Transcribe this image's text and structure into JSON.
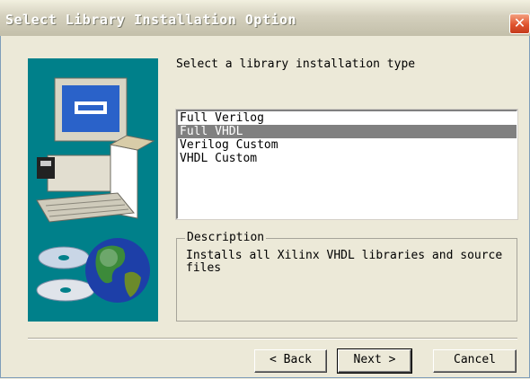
{
  "window": {
    "title": "Select Library Installation Option",
    "close_icon": "close-icon"
  },
  "main": {
    "prompt": "Select a library installation type",
    "options": [
      "Full Verilog",
      "Full VHDL",
      "Verilog Custom",
      "VHDL Custom"
    ],
    "selected_option": "Full VHDL",
    "description_label": "Description",
    "description_line1": "Installs all Xilinx VHDL libraries and source",
    "description_line2": "files"
  },
  "buttons": {
    "back_label": "< Back",
    "next_label": "Next >",
    "cancel_label": "Cancel"
  },
  "colors": {
    "side_panel": "#00808a",
    "selection": "#808080",
    "close_button": "#e0532e"
  },
  "icons": [
    "computer-icon",
    "cd-icon",
    "globe-icon"
  ]
}
